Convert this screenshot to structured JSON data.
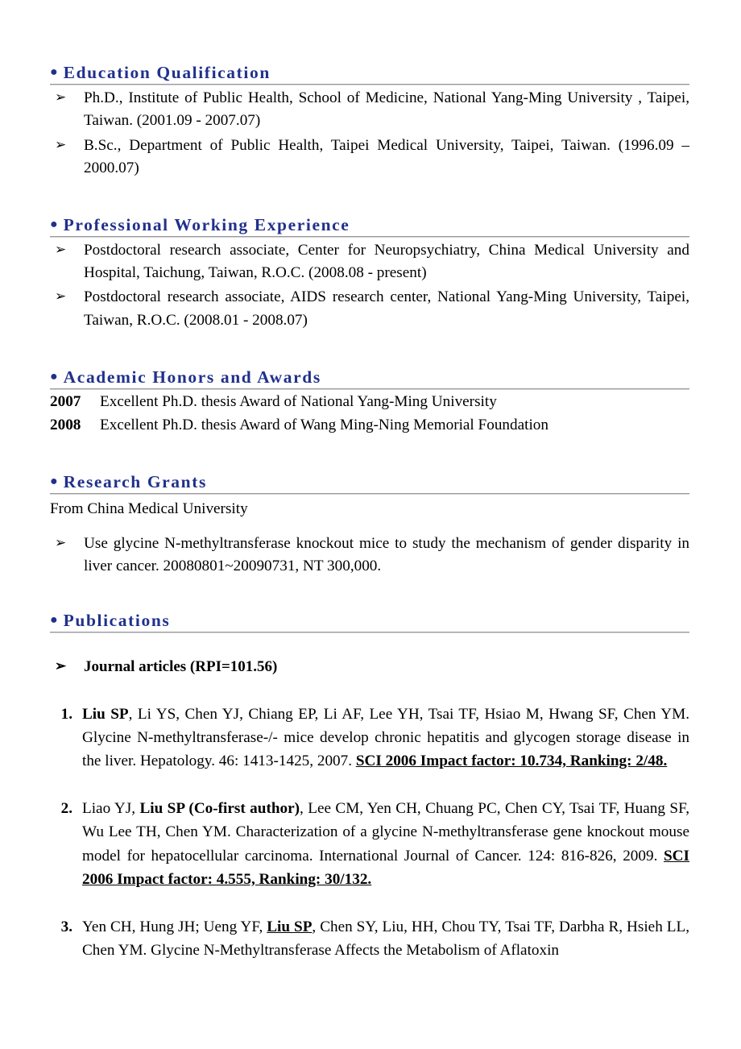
{
  "document": {
    "bullet_glyph": "●",
    "arrow_glyph": "➢",
    "heading_color": "#20308C",
    "body_color": "#000000"
  },
  "sections": {
    "education": {
      "heading": "Education Qualification",
      "items": [
        "Ph.D., Institute of Public Health, School of Medicine, National Yang-Ming University , Taipei, Taiwan.  (2001.09 - 2007.07)",
        "B.Sc., Department of Public Health, Taipei Medical University, Taipei, Taiwan. (1996.09 – 2000.07)"
      ]
    },
    "experience": {
      "heading": "Professional Working Experience",
      "items": [
        "Postdoctoral research associate, Center for Neuropsychiatry, China Medical University and Hospital, Taichung, Taiwan, R.O.C. (2008.08 - present)",
        "Postdoctoral research associate, AIDS research center, National Yang-Ming University, Taipei, Taiwan, R.O.C. (2008.01 - 2008.07)"
      ]
    },
    "honors": {
      "heading": "Academic Honors and Awards",
      "items": [
        {
          "year": "2007",
          "text": "Excellent Ph.D. thesis Award of National Yang-Ming University"
        },
        {
          "year": "2008",
          "text": "Excellent Ph.D. thesis Award of Wang Ming-Ning Memorial Foundation"
        }
      ]
    },
    "grants": {
      "heading": "Research Grants",
      "source": "From China Medical University",
      "items": [
        "Use glycine N-methyltransferase knockout mice to study the mechanism of gender disparity in liver cancer.  20080801~20090731, NT 300,000."
      ]
    },
    "publications": {
      "heading": "Publications",
      "subheading": "Journal articles (RPI=101.56)",
      "entries": [
        {
          "number": "1.",
          "authors_bold": "Liu SP",
          "authors_rest": ", Li YS, Chen YJ, Chiang EP, Li AF, Lee YH, Tsai TF, Hsiao M, Hwang SF, Chen YM. ",
          "title": "Glycine N-methyltransferase-/- mice develop chronic hepatitis and glycogen storage disease in the liver. ",
          "journal": "Hepatology. 46: 1413-1425, 2007. ",
          "metric": "SCI 2006 Impact factor: 10.734, Ranking: 2/48."
        },
        {
          "number": "2.",
          "authors_pre": "Liao YJ, ",
          "authors_bold": "Liu SP (Co-first author)",
          "authors_rest": ", Lee CM, Yen CH, Chuang PC, Chen CY, Tsai TF, Huang SF, Wu Lee TH, Chen YM. ",
          "title": "Characterization of a glycine N-methyltransferase gene knockout mouse model for hepatocellular carcinoma. ",
          "journal": "International Journal of Cancer. 124: 816-826, 2009. ",
          "metric": "SCI 2006 Impact factor: 4.555, Ranking: 30/132."
        },
        {
          "number": "3.",
          "authors_pre": "Yen CH, Hung JH; Ueng YF, ",
          "authors_bold_underline": "Liu SP",
          "authors_rest": ", Chen SY, Liu, HH, Chou TY, Tsai TF, Darbha R, Hsieh LL, Chen YM. ",
          "title": "Glycine N-Methyltransferase Affects the Metabolism of Aflatoxin"
        }
      ]
    }
  }
}
